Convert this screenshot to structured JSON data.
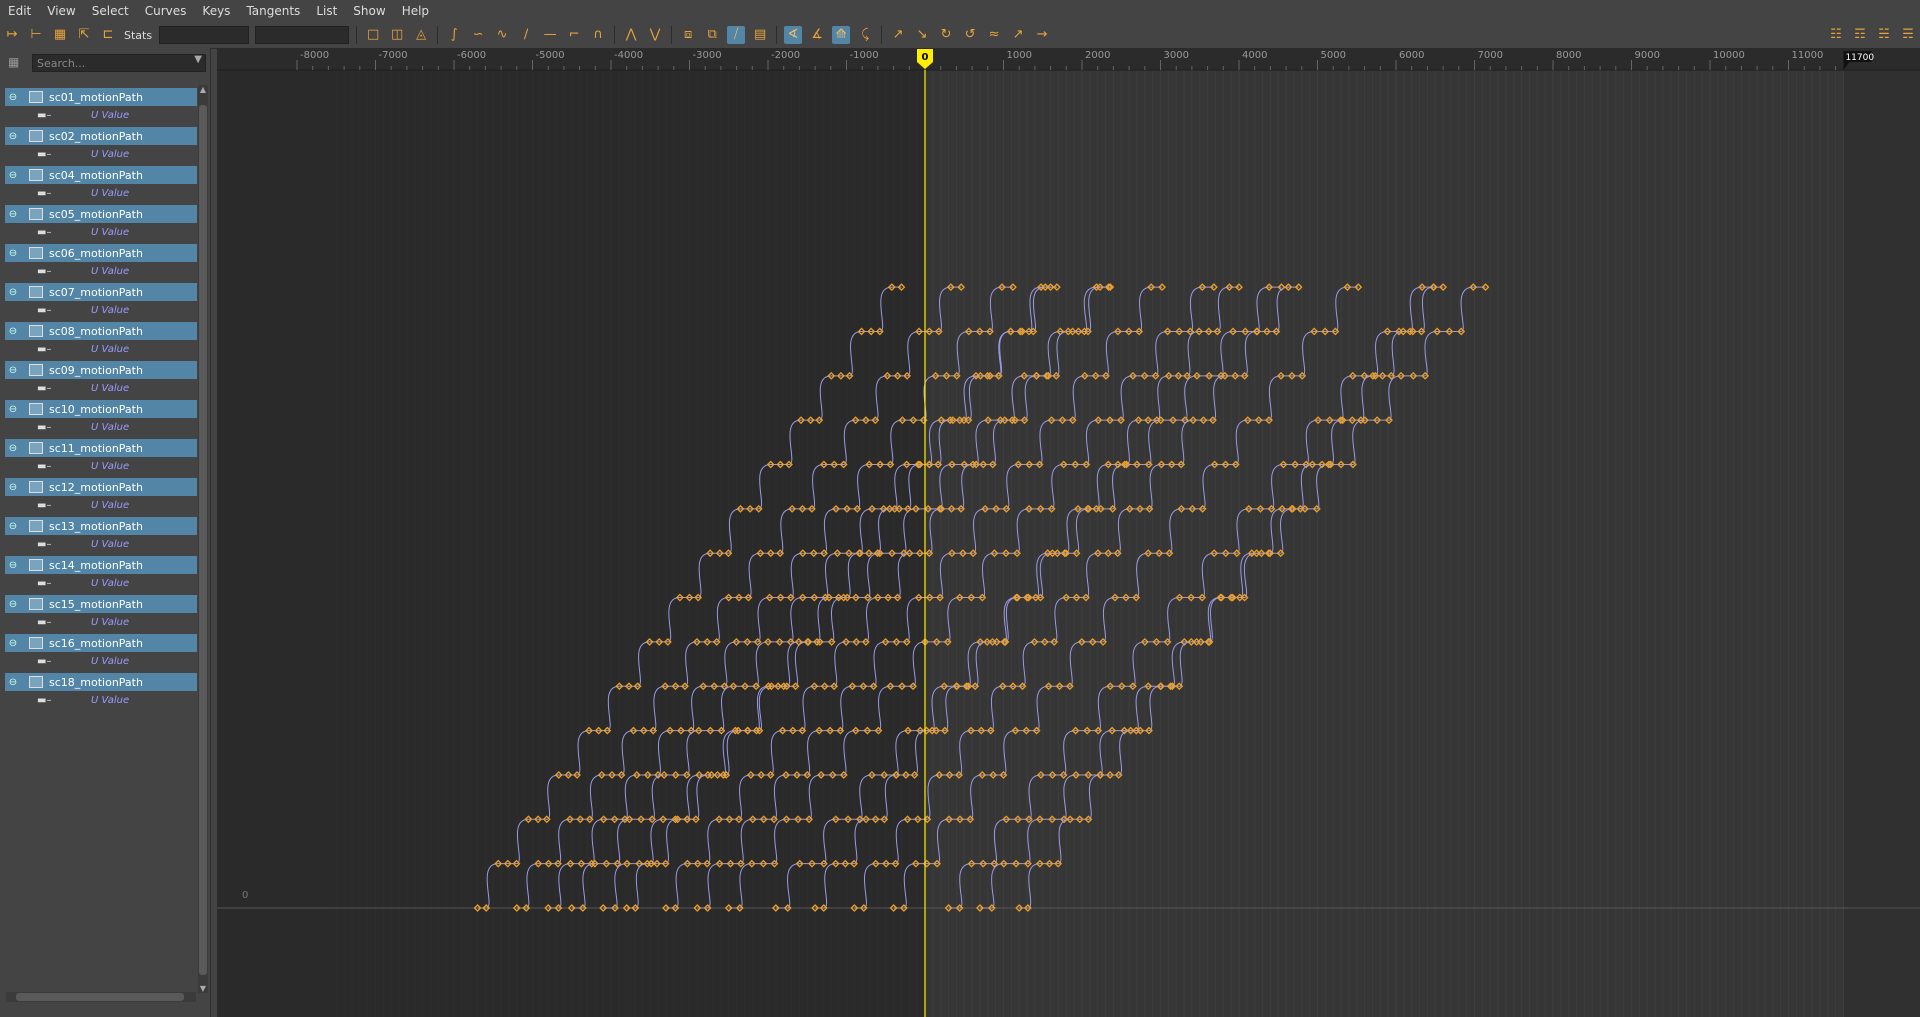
{
  "menu": [
    "Edit",
    "View",
    "Select",
    "Curves",
    "Keys",
    "Tangents",
    "List",
    "Show",
    "Help"
  ],
  "toolbar": {
    "stats_label": "Stats",
    "icons": [
      "move-key-icon",
      "insert-key-icon",
      "lattice-icon",
      "region-select-icon",
      "retime-icon",
      "frame-all-icon",
      "frame-selection-icon",
      "frame-playback-icon",
      "auto-tangent-icon",
      "spline-tangent-icon",
      "clamped-tangent-icon",
      "linear-tangent-icon",
      "flat-tangent-icon",
      "step-tangent-icon",
      "plateau-tangent-icon",
      "break-tangent-icon",
      "unify-tangent-icon",
      "free-weight-icon",
      "lock-weight-icon",
      "weighted-tangent-icon",
      "buffer-curve-icon",
      "normalize-icon",
      "denormalize-icon",
      "snap-icon",
      "magnet-icon",
      "pre-infinity-icon",
      "post-infinity-icon",
      "cycle-icon",
      "cycle-offset-icon",
      "oscillate-icon",
      "linear-infinity-icon",
      "constant-infinity-icon",
      "dope-sheet-icon",
      "trax-icon",
      "time-editor-icon",
      "graph-editor-icon"
    ]
  },
  "outliner": {
    "search_placeholder": "Search...",
    "items": [
      {
        "name": "sc01_motionPath",
        "attr": "U Value"
      },
      {
        "name": "sc02_motionPath",
        "attr": "U Value"
      },
      {
        "name": "sc04_motionPath",
        "attr": "U Value"
      },
      {
        "name": "sc05_motionPath",
        "attr": "U Value"
      },
      {
        "name": "sc06_motionPath",
        "attr": "U Value"
      },
      {
        "name": "sc07_motionPath",
        "attr": "U Value"
      },
      {
        "name": "sc08_motionPath",
        "attr": "U Value"
      },
      {
        "name": "sc09_motionPath",
        "attr": "U Value"
      },
      {
        "name": "sc10_motionPath",
        "attr": "U Value"
      },
      {
        "name": "sc11_motionPath",
        "attr": "U Value"
      },
      {
        "name": "sc12_motionPath",
        "attr": "U Value"
      },
      {
        "name": "sc13_motionPath",
        "attr": "U Value"
      },
      {
        "name": "sc14_motionPath",
        "attr": "U Value"
      },
      {
        "name": "sc15_motionPath",
        "attr": "U Value"
      },
      {
        "name": "sc16_motionPath",
        "attr": "U Value"
      },
      {
        "name": "sc18_motionPath",
        "attr": "U Value"
      }
    ]
  },
  "graph": {
    "current_time": "0",
    "end_time": "11700",
    "y_zero_label": "0",
    "ruler_ticks": [
      "-8000",
      "-7000",
      "-6000",
      "-5000",
      "-4000",
      "-3000",
      "-2000",
      "-1000",
      "1000",
      "2000",
      "3000",
      "4000",
      "5000",
      "6000",
      "7000",
      "8000",
      "9000",
      "10000",
      "11000"
    ],
    "colors": {
      "curve": "#9b9ae6",
      "key": "#f0a020",
      "current_time": "#ffee00",
      "selection_bg": "#5285a6"
    }
  }
}
